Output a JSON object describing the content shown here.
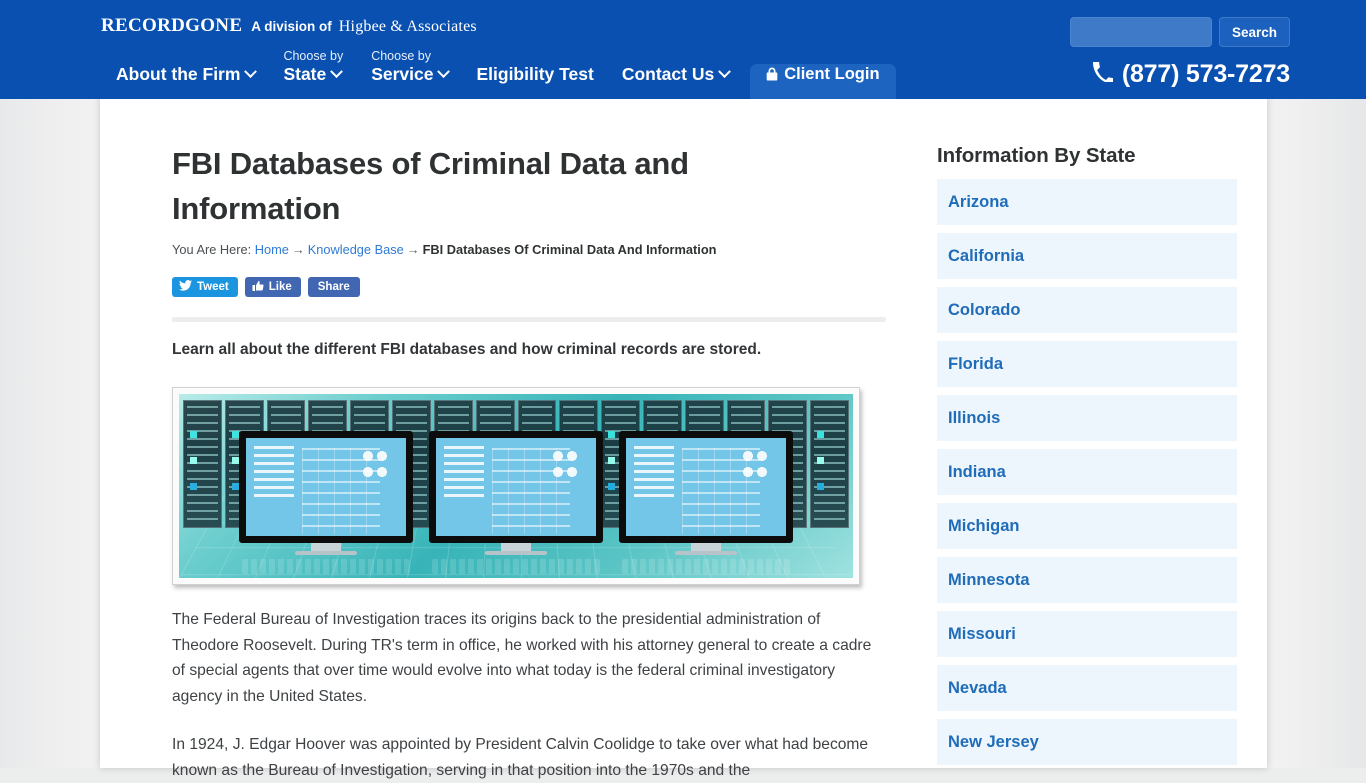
{
  "header": {
    "brand_main": "RECORDGONE",
    "brand_division": "A division of",
    "brand_firm": "Higbee & Associates",
    "search": {
      "value": "",
      "placeholder": "",
      "button_label": "Search",
      "icon": "search-icon"
    },
    "phone": {
      "number": "(877) 573-7273",
      "icon": "phone-icon"
    },
    "nav": [
      {
        "pre": "",
        "label": "About the Firm",
        "caret": true
      },
      {
        "pre": "Choose by",
        "label": "State",
        "caret": true
      },
      {
        "pre": "Choose by",
        "label": "Service",
        "caret": true
      },
      {
        "pre": "",
        "label": "Eligibility Test",
        "caret": false
      },
      {
        "pre": "",
        "label": "Contact Us",
        "caret": true
      },
      {
        "pre": "",
        "label": "Client Login",
        "caret": false,
        "icon": "lock-icon",
        "highlighted": true
      }
    ]
  },
  "article": {
    "title": "FBI Databases of Criminal Data and Information",
    "breadcrumb": {
      "prefix": "You Are Here:",
      "home": "Home",
      "section": "Knowledge Base",
      "current": "FBI Databases Of Criminal Data And Information",
      "separator": "→"
    },
    "share": {
      "tweet_label": "Tweet",
      "like_label": "Like",
      "share_label": "Share",
      "tweet_icon": "twitter-bird-icon",
      "like_icon": "thumbs-up-icon"
    },
    "lede": "Learn all about the different FBI databases and how criminal records are stored.",
    "hero_image_alt": "Row of server racks with three computer monitors and keyboards in a data center",
    "paragraphs": [
      "The Federal Bureau of Investigation traces its origins back to the presidential administration of Theodore Roosevelt. During TR's term in office, he worked with his attorney general to create a cadre of special agents that over time would evolve into what today is the federal criminal investigatory agency in the United States.",
      "In 1924, J. Edgar Hoover was appointed by President Calvin Coolidge to take over what had become known as the Bureau of Investigation, serving in that position into the 1970s and the"
    ]
  },
  "sidebar": {
    "title": "Information By State",
    "states": [
      {
        "label": "Arizona"
      },
      {
        "label": "California"
      },
      {
        "label": "Colorado"
      },
      {
        "label": "Florida"
      },
      {
        "label": "Illinois"
      },
      {
        "label": "Indiana"
      },
      {
        "label": "Michigan"
      },
      {
        "label": "Minnesota"
      },
      {
        "label": "Missouri"
      },
      {
        "label": "Nevada"
      },
      {
        "label": "New Jersey"
      }
    ]
  },
  "colors": {
    "header_blue": "#0a50b0",
    "login_blue": "#1d64c0",
    "link_blue": "#1f6cb8",
    "breadcrumb_link": "#2f7bd4",
    "sidebar_item_bg": "#eef6fd",
    "twitter_blue": "#1b95e0",
    "facebook_blue": "#4267b2",
    "body_text": "#3e4245"
  }
}
